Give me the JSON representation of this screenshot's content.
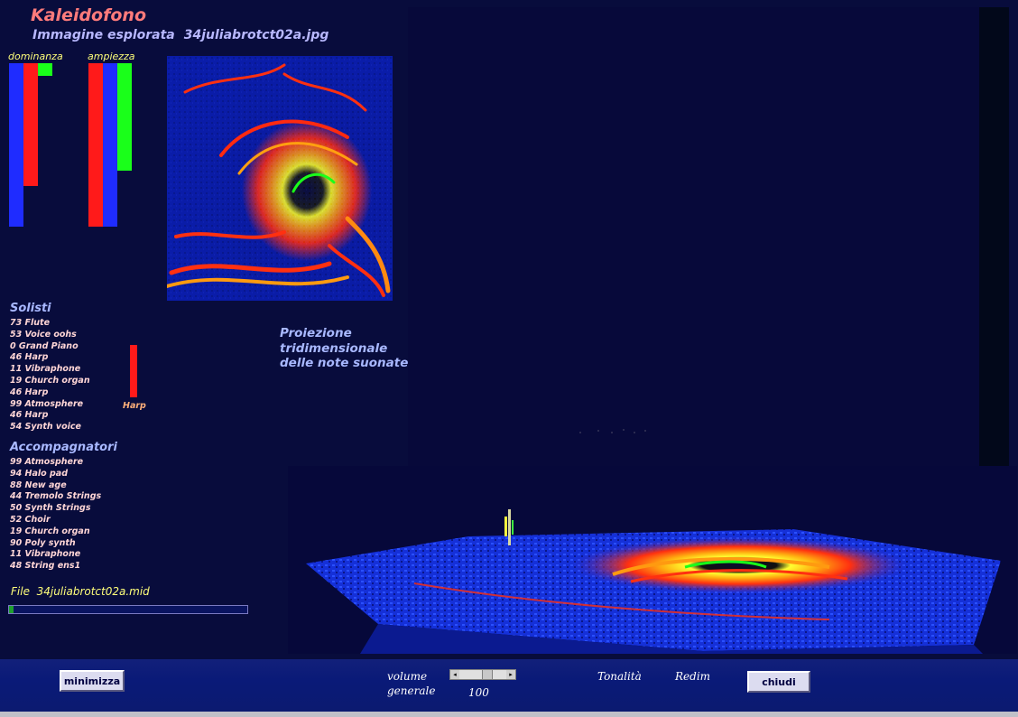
{
  "app": {
    "title": "Kaleidofono",
    "image_label": "Immagine esplorata",
    "image_file": "34juliabrotct02a.jpg"
  },
  "bars": {
    "dominanza_label": "dominanza",
    "ampiezza_label": "ampiezza",
    "dominanza": [
      {
        "color": "#1f2cff",
        "level": 1.0
      },
      {
        "color": "#ff1a1a",
        "level": 0.75
      },
      {
        "color": "#1aff1a",
        "level": 0.08
      }
    ],
    "ampiezza": [
      {
        "color": "#ff1a1a",
        "level": 1.0
      },
      {
        "color": "#1f2cff",
        "level": 1.0
      },
      {
        "color": "#1aff1a",
        "level": 0.66
      }
    ]
  },
  "solisti": {
    "heading": "Solisti",
    "items": [
      "73 Flute",
      "53 Voice oohs",
      "0  Grand Piano",
      "46 Harp",
      "11 Vibraphone",
      "19 Church organ",
      "46 Harp",
      "99 Atmosphere",
      "46 Harp",
      "54 Synth voice"
    ],
    "current_label": "Harp",
    "current_color": "#ff1a1a"
  },
  "accompagnatori": {
    "heading": "Accompagnatori",
    "items": [
      "99 Atmosphere",
      "94 Halo pad",
      "88 New age",
      "44 Tremolo Strings",
      "50 Synth Strings",
      "52 Choir",
      "19 Church organ",
      "90 Poly synth",
      "11 Vibraphone",
      "48 String ens1"
    ]
  },
  "projection": {
    "line1": "Proiezione",
    "line2": "tridimensionale",
    "line3": "delle note suonate"
  },
  "file": {
    "label": "File",
    "name": "34juliabrotct02a.mid",
    "progress": 0.02
  },
  "controls": {
    "minimize_label": "minimizza",
    "volume_label": "volume",
    "generale_label": "generale",
    "volume_value": "100",
    "volume_level": 0.6,
    "tonalita_label": "Tonalità",
    "redim_label": "Redim",
    "close_label": "chiudi"
  }
}
